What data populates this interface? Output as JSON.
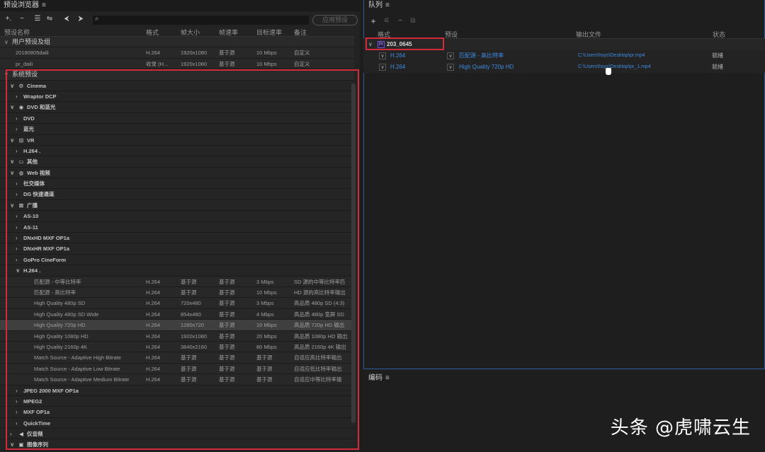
{
  "left": {
    "title": "预设浏览器",
    "menu": "≡",
    "apply": "应用预设",
    "toolbar": [
      "+.",
      "−",
      "☰",
      "⇋",
      "⮜",
      "⮞",
      "⌕"
    ],
    "headers": [
      "预设名称",
      "格式",
      "帧大小",
      "帧速率",
      "目标速率",
      "备注"
    ],
    "rows": [
      {
        "k": "grp",
        "chev": "∨",
        "d": 0,
        "name": "用户预设及组"
      },
      {
        "k": "leaf",
        "d": 2,
        "name": "20180805daili",
        "f": "H.264",
        "s": "1920x1080",
        "r": "基于源",
        "b": "10 Mbps",
        "n": "自定义"
      },
      {
        "k": "leaf",
        "d": 2,
        "name": "pr_daili",
        "f": "收录 (H...",
        "s": "1920x1080",
        "r": "基于源",
        "b": "10 Mbps",
        "n": "自定义"
      },
      {
        "k": "grp",
        "chev": "∨",
        "d": 0,
        "name": "系统预设"
      },
      {
        "k": "sub",
        "chev": "∨",
        "d": 1,
        "icon": "⚙",
        "name": "Cinema"
      },
      {
        "k": "sub",
        "chev": "›",
        "d": 2,
        "name": "Wraptor DCP"
      },
      {
        "k": "sub",
        "chev": "∨",
        "d": 1,
        "icon": "◉",
        "name": "DVD 和蓝光"
      },
      {
        "k": "sub",
        "chev": "›",
        "d": 2,
        "name": "DVD"
      },
      {
        "k": "sub",
        "chev": "›",
        "d": 2,
        "name": "蓝光"
      },
      {
        "k": "sub",
        "chev": "∨",
        "d": 1,
        "icon": "⊡",
        "name": "VR"
      },
      {
        "k": "sub",
        "chev": "›",
        "d": 2,
        "name": "H.264   ."
      },
      {
        "k": "sub",
        "chev": "∨",
        "d": 1,
        "icon": "▭",
        "name": "其他"
      },
      {
        "k": "sub",
        "chev": "∨",
        "d": 1,
        "icon": "◍",
        "name": "Web 视频"
      },
      {
        "k": "sub",
        "chev": "›",
        "d": 2,
        "name": "社交媒体"
      },
      {
        "k": "sub",
        "chev": "›",
        "d": 2,
        "name": "DG 快速通道"
      },
      {
        "k": "sub",
        "chev": "∨",
        "d": 1,
        "icon": "⊠",
        "name": "广播"
      },
      {
        "k": "sub",
        "chev": "›",
        "d": 2,
        "name": "AS-10"
      },
      {
        "k": "sub",
        "chev": "›",
        "d": 2,
        "name": "AS-11"
      },
      {
        "k": "sub",
        "chev": "›",
        "d": 2,
        "name": "DNxHD MXF OP1a"
      },
      {
        "k": "sub",
        "chev": "›",
        "d": 2,
        "name": "DNxHR MXF OP1a"
      },
      {
        "k": "sub",
        "chev": "›",
        "d": 2,
        "name": "GoPro CineForm"
      },
      {
        "k": "sub",
        "chev": "∨",
        "d": 2,
        "name": "H.264   ."
      },
      {
        "k": "leaf",
        "d": 3,
        "name": "匹配源 - 中等比特率",
        "f": "H.264",
        "s": "基于源",
        "r": "基于源",
        "b": "3 Mbps",
        "n": "SD 源的中等比特率匹"
      },
      {
        "k": "leaf",
        "d": 3,
        "name": "匹配源 - 高比特率",
        "f": "H.264",
        "s": "基于源",
        "r": "基于源",
        "b": "10 Mbps",
        "n": "HD 源的高比特率输出"
      },
      {
        "k": "leaf",
        "d": 3,
        "name": "High Quality 480p SD",
        "f": "H.264",
        "s": "720x480",
        "r": "基于源",
        "b": "3 Mbps",
        "n": "高品质 480p SD (4:3)"
      },
      {
        "k": "leaf",
        "d": 3,
        "name": "High Quality 480p SD Wide",
        "f": "H.264",
        "s": "854x480",
        "r": "基于源",
        "b": "4 Mbps",
        "n": "高品质 480p 宽屏 SD"
      },
      {
        "k": "leaf",
        "sel": true,
        "d": 3,
        "name": "High Quality 720p HD",
        "f": "H.264",
        "s": "1280x720",
        "r": "基于源",
        "b": "10 Mbps",
        "n": "高品质 720p HD 输出"
      },
      {
        "k": "leaf",
        "d": 3,
        "name": "High Quality 1080p HD",
        "f": "H.264",
        "s": "1920x1080",
        "r": "基于源",
        "b": "20 Mbps",
        "n": "高品质 1080p HD 输出"
      },
      {
        "k": "leaf",
        "d": 3,
        "name": "High Quality 2160p 4K",
        "f": "H.264",
        "s": "3840x2160",
        "r": "基于源",
        "b": "80 Mbps",
        "n": "高品质 2160p 4K 输出"
      },
      {
        "k": "leaf",
        "d": 3,
        "name": "Match Source - Adaptive High Bitrate",
        "f": "H.264",
        "s": "基于源",
        "r": "基于源",
        "b": "基于源",
        "n": "自适应高比特率输出"
      },
      {
        "k": "leaf",
        "d": 3,
        "name": "Match Source - Adaptive Low Bitrate",
        "f": "H.264",
        "s": "基于源",
        "r": "基于源",
        "b": "基于源",
        "n": "自适应低比特率输出"
      },
      {
        "k": "leaf",
        "d": 3,
        "name": "Match Source - Adaptive Medium Bitrate",
        "f": "H.264",
        "s": "基于源",
        "r": "基于源",
        "b": "基于源",
        "n": "自适应中等比特率输"
      },
      {
        "k": "sub",
        "chev": "›",
        "d": 2,
        "name": "JPEG 2000 MXF OP1a"
      },
      {
        "k": "sub",
        "chev": "›",
        "d": 2,
        "name": "MPEG2"
      },
      {
        "k": "sub",
        "chev": "›",
        "d": 2,
        "name": "MXF OP1a"
      },
      {
        "k": "sub",
        "chev": "›",
        "d": 2,
        "name": "QuickTime"
      },
      {
        "k": "sub",
        "chev": "›",
        "d": 1,
        "icon": "◀",
        "name": "仅音频"
      },
      {
        "k": "sub",
        "chev": "∨",
        "d": 1,
        "icon": "▣",
        "name": "图像序列"
      }
    ]
  },
  "queue": {
    "title": "队列",
    "menu": "≡",
    "toolbar": [
      "+",
      "⚟",
      "−",
      "⧉"
    ],
    "headers": [
      "格式",
      "预设",
      "输出文件",
      "状态"
    ],
    "group": {
      "label": "203_0645",
      "badge": "Pr"
    },
    "items": [
      {
        "format": "H.264",
        "preset": "匹配源 - 高比特率",
        "output": "C:\\Users\\hsys\\Desktop\\pr.mp4",
        "status": "就绪"
      },
      {
        "format": "H.264",
        "preset": "High Quality 720p HD",
        "output": "C:\\Users\\hsys\\Desktop\\pr_1.mp4",
        "status": "就绪"
      }
    ]
  },
  "encode": {
    "title": "编码",
    "menu": "≡"
  },
  "watermark": "头条 @虎啸云生",
  "colors": {
    "accent": "#3e8be0",
    "highlight": "#d32b3a"
  }
}
